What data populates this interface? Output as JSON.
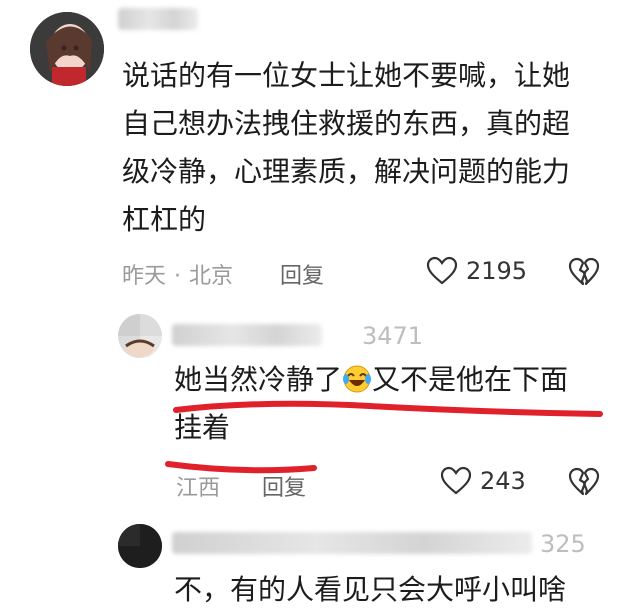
{
  "comments": [
    {
      "username_tail": "",
      "text_lines": [
        "说话的有一位女士让她不要喊，让她",
        "自己想办法拽住救援的东西，真的超",
        "级冷静，心理素质，解决问题的能力",
        "杠杠的"
      ],
      "time": "昨天",
      "location": "北京",
      "reply_label": "回复",
      "like_count": "2195"
    },
    {
      "username_tail": "3471",
      "text_line1_before": "她当然冷静了",
      "emoji": "laughing-crying",
      "text_line1_after": "又不是他在下面",
      "text_line2": "挂着",
      "location": "江西",
      "reply_label": "回复",
      "like_count": "243",
      "highlight_color": "#e0202a"
    },
    {
      "username_tail": "325",
      "text_line1": "不，有的人看见只会大呼小叫啥"
    }
  ]
}
